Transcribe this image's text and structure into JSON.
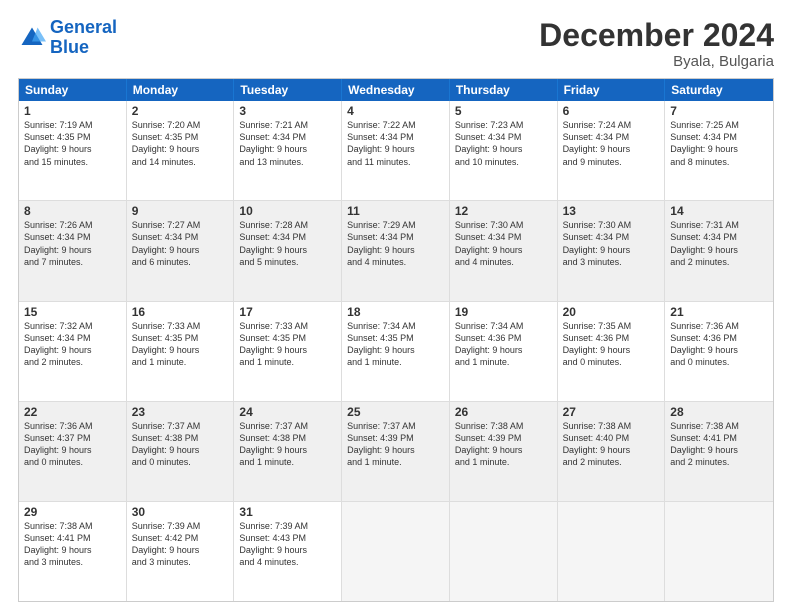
{
  "logo": {
    "line1": "General",
    "line2": "Blue"
  },
  "title": "December 2024",
  "subtitle": "Byala, Bulgaria",
  "days": [
    "Sunday",
    "Monday",
    "Tuesday",
    "Wednesday",
    "Thursday",
    "Friday",
    "Saturday"
  ],
  "rows": [
    [
      {
        "day": "1",
        "text": "Sunrise: 7:19 AM\nSunset: 4:35 PM\nDaylight: 9 hours\nand 15 minutes."
      },
      {
        "day": "2",
        "text": "Sunrise: 7:20 AM\nSunset: 4:35 PM\nDaylight: 9 hours\nand 14 minutes."
      },
      {
        "day": "3",
        "text": "Sunrise: 7:21 AM\nSunset: 4:34 PM\nDaylight: 9 hours\nand 13 minutes."
      },
      {
        "day": "4",
        "text": "Sunrise: 7:22 AM\nSunset: 4:34 PM\nDaylight: 9 hours\nand 11 minutes."
      },
      {
        "day": "5",
        "text": "Sunrise: 7:23 AM\nSunset: 4:34 PM\nDaylight: 9 hours\nand 10 minutes."
      },
      {
        "day": "6",
        "text": "Sunrise: 7:24 AM\nSunset: 4:34 PM\nDaylight: 9 hours\nand 9 minutes."
      },
      {
        "day": "7",
        "text": "Sunrise: 7:25 AM\nSunset: 4:34 PM\nDaylight: 9 hours\nand 8 minutes."
      }
    ],
    [
      {
        "day": "8",
        "text": "Sunrise: 7:26 AM\nSunset: 4:34 PM\nDaylight: 9 hours\nand 7 minutes."
      },
      {
        "day": "9",
        "text": "Sunrise: 7:27 AM\nSunset: 4:34 PM\nDaylight: 9 hours\nand 6 minutes."
      },
      {
        "day": "10",
        "text": "Sunrise: 7:28 AM\nSunset: 4:34 PM\nDaylight: 9 hours\nand 5 minutes."
      },
      {
        "day": "11",
        "text": "Sunrise: 7:29 AM\nSunset: 4:34 PM\nDaylight: 9 hours\nand 4 minutes."
      },
      {
        "day": "12",
        "text": "Sunrise: 7:30 AM\nSunset: 4:34 PM\nDaylight: 9 hours\nand 4 minutes."
      },
      {
        "day": "13",
        "text": "Sunrise: 7:30 AM\nSunset: 4:34 PM\nDaylight: 9 hours\nand 3 minutes."
      },
      {
        "day": "14",
        "text": "Sunrise: 7:31 AM\nSunset: 4:34 PM\nDaylight: 9 hours\nand 2 minutes."
      }
    ],
    [
      {
        "day": "15",
        "text": "Sunrise: 7:32 AM\nSunset: 4:34 PM\nDaylight: 9 hours\nand 2 minutes."
      },
      {
        "day": "16",
        "text": "Sunrise: 7:33 AM\nSunset: 4:35 PM\nDaylight: 9 hours\nand 1 minute."
      },
      {
        "day": "17",
        "text": "Sunrise: 7:33 AM\nSunset: 4:35 PM\nDaylight: 9 hours\nand 1 minute."
      },
      {
        "day": "18",
        "text": "Sunrise: 7:34 AM\nSunset: 4:35 PM\nDaylight: 9 hours\nand 1 minute."
      },
      {
        "day": "19",
        "text": "Sunrise: 7:34 AM\nSunset: 4:36 PM\nDaylight: 9 hours\nand 1 minute."
      },
      {
        "day": "20",
        "text": "Sunrise: 7:35 AM\nSunset: 4:36 PM\nDaylight: 9 hours\nand 0 minutes."
      },
      {
        "day": "21",
        "text": "Sunrise: 7:36 AM\nSunset: 4:36 PM\nDaylight: 9 hours\nand 0 minutes."
      }
    ],
    [
      {
        "day": "22",
        "text": "Sunrise: 7:36 AM\nSunset: 4:37 PM\nDaylight: 9 hours\nand 0 minutes."
      },
      {
        "day": "23",
        "text": "Sunrise: 7:37 AM\nSunset: 4:38 PM\nDaylight: 9 hours\nand 0 minutes."
      },
      {
        "day": "24",
        "text": "Sunrise: 7:37 AM\nSunset: 4:38 PM\nDaylight: 9 hours\nand 1 minute."
      },
      {
        "day": "25",
        "text": "Sunrise: 7:37 AM\nSunset: 4:39 PM\nDaylight: 9 hours\nand 1 minute."
      },
      {
        "day": "26",
        "text": "Sunrise: 7:38 AM\nSunset: 4:39 PM\nDaylight: 9 hours\nand 1 minute."
      },
      {
        "day": "27",
        "text": "Sunrise: 7:38 AM\nSunset: 4:40 PM\nDaylight: 9 hours\nand 2 minutes."
      },
      {
        "day": "28",
        "text": "Sunrise: 7:38 AM\nSunset: 4:41 PM\nDaylight: 9 hours\nand 2 minutes."
      }
    ],
    [
      {
        "day": "29",
        "text": "Sunrise: 7:38 AM\nSunset: 4:41 PM\nDaylight: 9 hours\nand 3 minutes."
      },
      {
        "day": "30",
        "text": "Sunrise: 7:39 AM\nSunset: 4:42 PM\nDaylight: 9 hours\nand 3 minutes."
      },
      {
        "day": "31",
        "text": "Sunrise: 7:39 AM\nSunset: 4:43 PM\nDaylight: 9 hours\nand 4 minutes."
      },
      {
        "day": "",
        "text": ""
      },
      {
        "day": "",
        "text": ""
      },
      {
        "day": "",
        "text": ""
      },
      {
        "day": "",
        "text": ""
      }
    ]
  ]
}
